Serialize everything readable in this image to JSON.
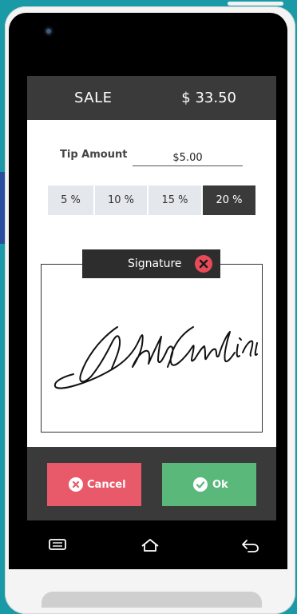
{
  "header": {
    "title": "SALE",
    "amount": "$ 33.50"
  },
  "tip": {
    "label": "Tip Amount",
    "value": "$5.00",
    "options": [
      {
        "label": "5 %",
        "selected": false
      },
      {
        "label": "10 %",
        "selected": false
      },
      {
        "label": "15 %",
        "selected": false
      },
      {
        "label": "20 %",
        "selected": true
      }
    ]
  },
  "signature": {
    "label": "Signature",
    "clear_icon": "close-icon"
  },
  "actions": {
    "cancel_label": "Cancel",
    "ok_label": "Ok",
    "cancel_color": "#e8596a",
    "ok_color": "#5ab87a"
  },
  "nav": {
    "icons": [
      "menu-icon",
      "home-icon",
      "back-icon"
    ]
  }
}
